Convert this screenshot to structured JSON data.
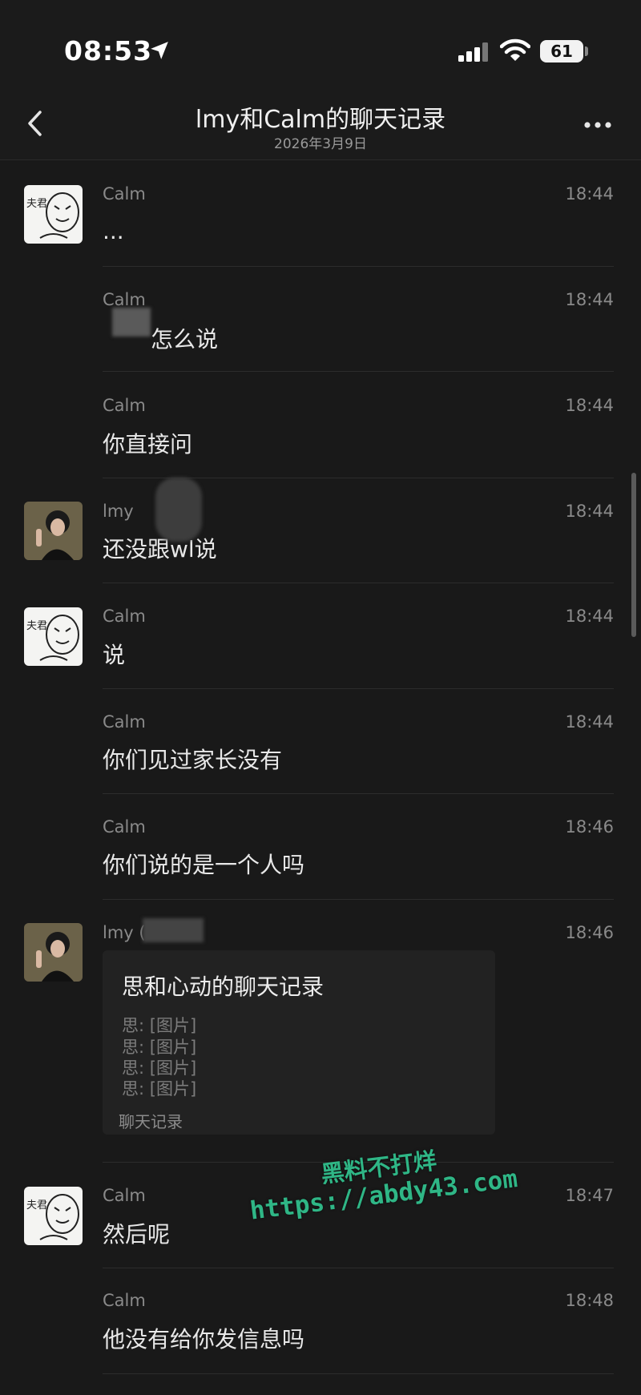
{
  "status_bar": {
    "time": "08:53",
    "battery": "61",
    "icons": [
      "location-arrow-icon",
      "signal-icon",
      "wifi-icon",
      "battery-icon"
    ]
  },
  "header": {
    "title": "lmy和Calm的聊天记录",
    "subtitle": "2026年3月9日",
    "icons": [
      "back-chevron-icon",
      "more-dots-icon"
    ]
  },
  "messages": [
    {
      "sender": "Calm",
      "time": "18:44",
      "text": "..."
    },
    {
      "sender": "Calm",
      "time": "18:44",
      "text": "怎么说"
    },
    {
      "sender": "Calm",
      "time": "18:44",
      "text": "你直接问"
    },
    {
      "sender": "lmy",
      "time": "18:44",
      "text": "还没跟wl说"
    },
    {
      "sender": "Calm",
      "time": "18:44",
      "text": "说"
    },
    {
      "sender": "Calm",
      "time": "18:44",
      "text": "你们见过家长没有"
    },
    {
      "sender": "Calm",
      "time": "18:46",
      "text": "你们说的是一个人吗"
    },
    {
      "sender": "lmy (",
      "time": "18:46",
      "text": ""
    },
    {
      "sender": "Calm",
      "time": "18:47",
      "text": "然后呢"
    },
    {
      "sender": "Calm",
      "time": "18:48",
      "text": "他没有给你发信息吗"
    }
  ],
  "chat_record_card": {
    "title": "思和心动的聊天记录",
    "lines": [
      "思: [图片]",
      "思: [图片]",
      "思: [图片]",
      "思: [图片]"
    ],
    "footer": "聊天记录"
  },
  "avatar_a_text": "夫君",
  "watermark": {
    "line1": "黑料不打烊",
    "line2": "https://abdy43.com"
  },
  "colors": {
    "background": "#191919",
    "watermark": "#2fb686"
  }
}
